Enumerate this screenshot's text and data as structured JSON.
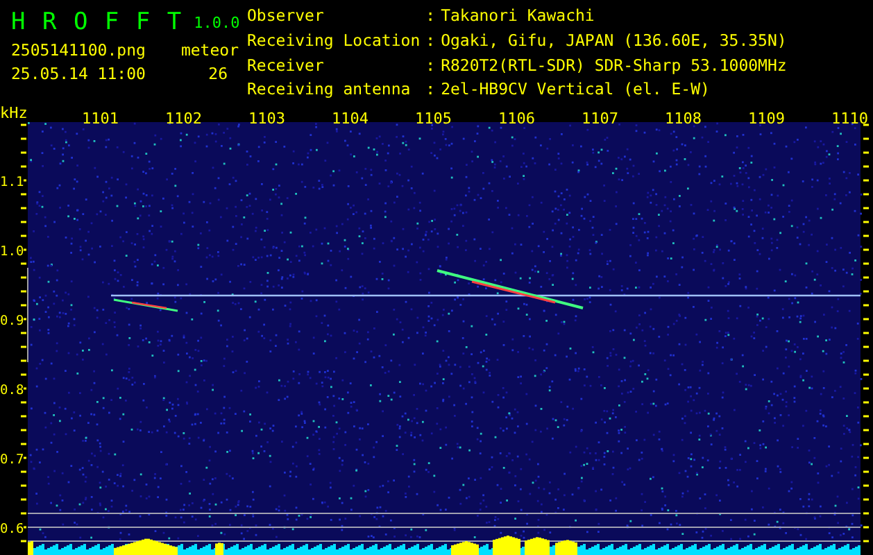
{
  "app": {
    "name": "H R O F F T",
    "version": "1.0.0"
  },
  "file": "2505141100.png",
  "datetime": "25.05.14 11:00",
  "meteor": {
    "label": "meteor",
    "count": "26"
  },
  "info": [
    {
      "label": "Observer",
      "separator": ":",
      "value": "Takanori Kawachi"
    },
    {
      "label": "Receiving Location",
      "separator": ":",
      "value": "Ogaki, Gifu, JAPAN (136.60E, 35.35N)"
    },
    {
      "label": "Receiver",
      "separator": ":",
      "value": "R820T2(RTL-SDR) SDR-Sharp 53.1000MHz"
    },
    {
      "label": "Receiving antenna",
      "separator": ":",
      "value": "2el-HB9CV Vertical (el. E-W)"
    }
  ],
  "spectrogram": {
    "unit_label": "kHz",
    "x_labels": [
      "1101",
      "1102",
      "1103",
      "1104",
      "1105",
      "1106",
      "1107",
      "1108",
      "1109",
      "1110"
    ],
    "y_labels": [
      "1.1",
      "1.0",
      "0.9",
      "0.8",
      "0.7",
      "0.6"
    ]
  }
}
